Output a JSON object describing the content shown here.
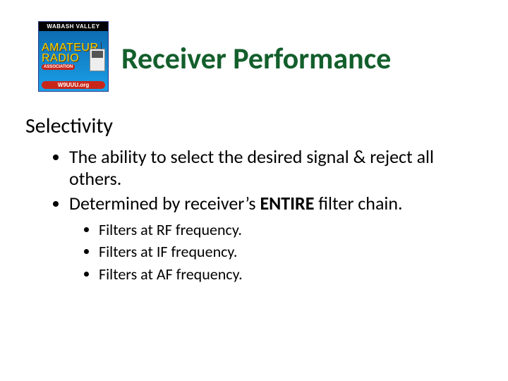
{
  "logo": {
    "top": "WABASH VALLEY",
    "line1": "AMATEUR",
    "line2": "RADIO",
    "assoc": "ASSOCIATION",
    "url": "W9UUU.org"
  },
  "title": "Receiver Performance",
  "section": "Selectivity",
  "bullets1": [
    "The ability to select the desired signal & reject all others.",
    {
      "pre": "Determined by receiver’s ",
      "bold": "ENTIRE",
      "post": " filter chain."
    }
  ],
  "bullets2": [
    "Filters at RF frequency.",
    "Filters at IF frequency.",
    "Filters at AF frequency."
  ]
}
